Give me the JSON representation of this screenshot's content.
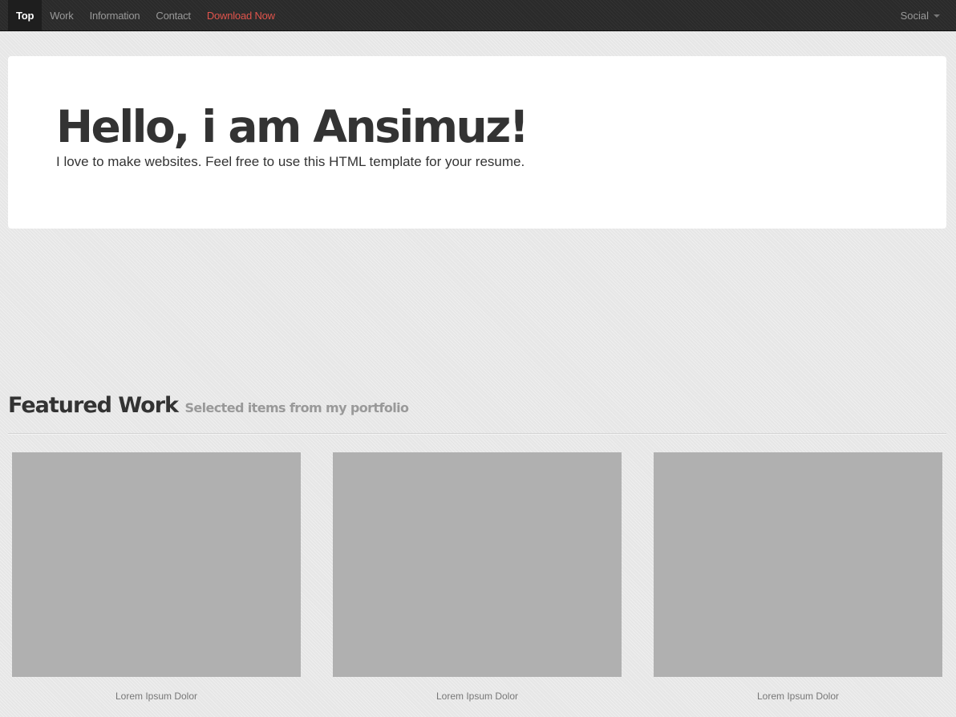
{
  "nav": {
    "items": [
      {
        "label": "Top"
      },
      {
        "label": "Work"
      },
      {
        "label": "Information"
      },
      {
        "label": "Contact"
      },
      {
        "label": "Download Now"
      }
    ],
    "social_label": "Social"
  },
  "hero": {
    "title": "Hello, i am Ansimuz!",
    "subtitle": "I love to make websites. Feel free to use this HTML template for your resume."
  },
  "featured": {
    "title": "Featured Work",
    "subtitle": "Selected items from my portfolio",
    "items": [
      {
        "caption": "Lorem Ipsum Dolor"
      },
      {
        "caption": "Lorem Ipsum Dolor"
      },
      {
        "caption": "Lorem Ipsum Dolor"
      }
    ]
  },
  "colors": {
    "navbar_bg": "#2a2a2a",
    "download_link": "#e0544c",
    "thumbnail_placeholder": "#b0b0b0"
  },
  "icons": {
    "social_dropdown": "caret-down-icon"
  }
}
